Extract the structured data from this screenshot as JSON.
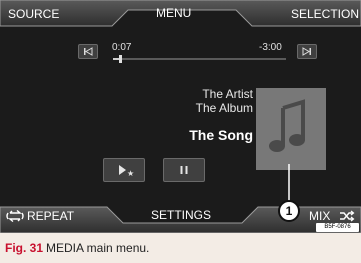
{
  "top_nav": {
    "source": "SOURCE",
    "menu": "MENU",
    "selection": "SELECTION"
  },
  "player": {
    "elapsed": "0:07",
    "remaining": "-3:00",
    "progress": 0.04,
    "artist": "The Artist",
    "album": "The Album",
    "song": "The Song"
  },
  "bottom_nav": {
    "repeat": "REPEAT",
    "settings": "SETTINGS",
    "mix": "MIX"
  },
  "callout": "1",
  "image_code": "B5F-0876",
  "caption": {
    "label": "Fig. 31",
    "text": "MEDIA main menu."
  },
  "colors": {
    "screen_bg": "#1b1b1b",
    "bar_bg": "#3a3a3a",
    "caption_bg": "#f3ece5",
    "caption_label": "#c8102e"
  },
  "icons": [
    "prev-track-icon",
    "next-track-icon",
    "play-favorite-icon",
    "pause-icon",
    "music-note-icon",
    "repeat-icon",
    "shuffle-icon"
  ]
}
